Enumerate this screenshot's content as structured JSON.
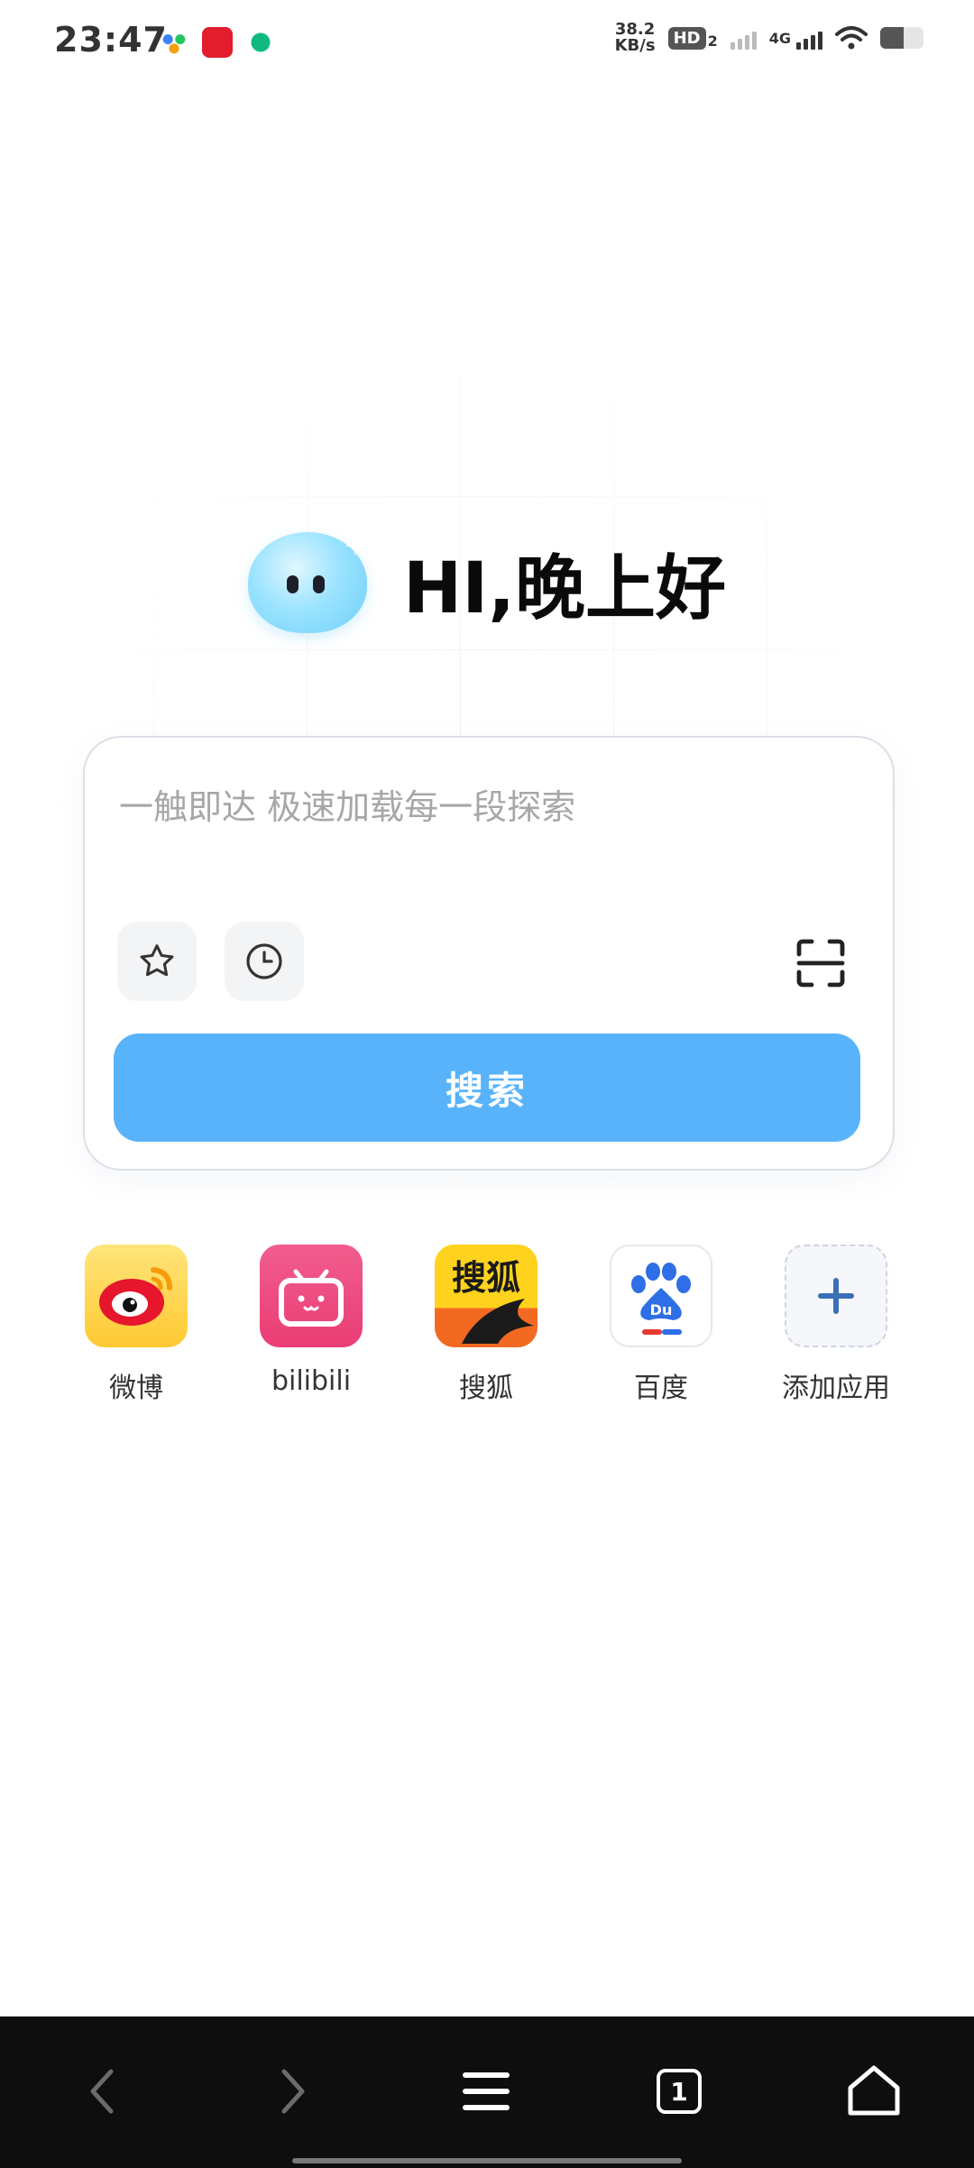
{
  "status_bar": {
    "time": "23:47",
    "speed_value": "38.2",
    "speed_unit": "KB/s",
    "hd_label": "HD",
    "hd_sim": "2",
    "network": "4G",
    "icons": [
      "baidu-netdisk-icon",
      "app-notification-icon",
      "china-mobile-icon",
      "signal-icon",
      "wifi-icon",
      "battery-icon"
    ]
  },
  "greeting": {
    "text": "HI,晚上好",
    "mascot": "mascot-icon"
  },
  "search": {
    "placeholder": "一触即达 极速加载每一段探索",
    "value": "",
    "search_button_label": "搜索",
    "tools": [
      "star-icon",
      "history-icon",
      "scan-icon"
    ]
  },
  "shortcuts": [
    {
      "label": "微博",
      "icon": "weibo-icon"
    },
    {
      "label": "bilibili",
      "icon": "bilibili-icon"
    },
    {
      "label": "搜狐",
      "icon": "sohu-icon"
    },
    {
      "label": "百度",
      "icon": "baidu-icon"
    },
    {
      "label": "添加应用",
      "icon": "add-icon"
    }
  ],
  "sohu_icon_text": "搜狐",
  "baidu_icon_text": "Du",
  "bottom_nav": {
    "tab_count": "1",
    "items": [
      "back-icon",
      "forward-icon",
      "menu-icon",
      "tabs-icon",
      "home-icon"
    ]
  },
  "colors": {
    "accent": "#58b3fb",
    "nav_bg": "#0e0e0e"
  }
}
